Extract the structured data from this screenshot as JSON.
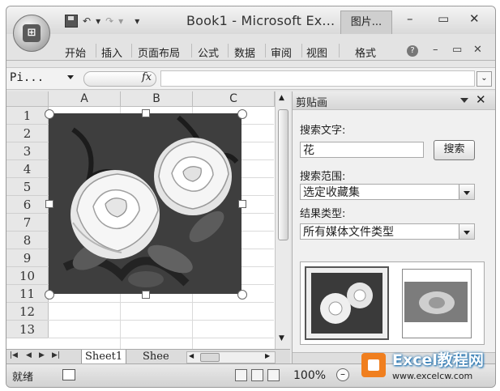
{
  "window": {
    "title": "Book1 - Microsoft Ex...",
    "context_tab": "图片...",
    "office_logo": "Office",
    "controls": [
      "–",
      "▭",
      "✕"
    ]
  },
  "quick_access": {
    "undo": "↶",
    "redo": "↷",
    "customize": "▾"
  },
  "ribbon": {
    "tabs": [
      "开始",
      "插入",
      "页面布局",
      "公式",
      "数据",
      "审阅",
      "视图"
    ],
    "context_tab": "格式",
    "help": "?",
    "doc_controls": [
      "–",
      "▭",
      "✕"
    ]
  },
  "formula_bar": {
    "name_box": "Pi...",
    "fx": "fx",
    "content": "",
    "expand": "⌄"
  },
  "sheet": {
    "columns": [
      "A",
      "B",
      "C"
    ],
    "rows": [
      "1",
      "2",
      "3",
      "4",
      "5",
      "6",
      "7",
      "8",
      "9",
      "10",
      "11",
      "12",
      "13"
    ],
    "tabs": [
      "Sheet1",
      "Shee"
    ],
    "selected_picture": "roses clip art"
  },
  "clip_art_pane": {
    "title": "剪贴画",
    "search_label": "搜索文字:",
    "search_value": "花",
    "search_button": "搜索",
    "scope_label": "搜索范围:",
    "scope_value": "选定收藏集",
    "type_label": "结果类型:",
    "type_value": "所有媒体文件类型",
    "close": "✕"
  },
  "status_bar": {
    "ready": "就绪",
    "zoom": "100%",
    "zoom_minus": "–"
  },
  "watermark": {
    "brand": "Excel教程网",
    "url": "www.excelcw.com"
  }
}
